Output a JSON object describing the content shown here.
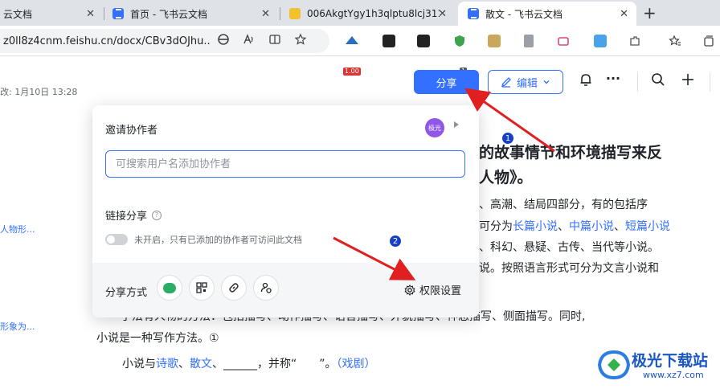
{
  "browser": {
    "tabs": [
      {
        "title": "云文档",
        "icon": "none",
        "active": false
      },
      {
        "title": "首页 - 飞书云文档",
        "icon": "doc",
        "active": false
      },
      {
        "title": "006AkgtYgy1h3qlptu8lcj311t0",
        "icon": "image",
        "active": false
      },
      {
        "title": "散文 - 飞书云文档",
        "icon": "doc",
        "active": true
      }
    ],
    "close_glyph": "✕",
    "new_tab_glyph": "+",
    "url": "z0ll8z4cnm.feishu.cn/docx/CBv3dOJhu...",
    "ext_badge_1": "1.00",
    "ext_badge_2": "1"
  },
  "doc_header": {
    "last_edit": "改: 1月10日 13:28",
    "share_label": "分享",
    "edit_label": "编辑",
    "more_glyph": "···"
  },
  "document": {
    "title_line1": "的故事情节和环境描写来反",
    "title_line2": "人物》。",
    "side_link_1": "人物形...",
    "side_link_2": "形象为...",
    "p1": "、高潮、结局四部分，有的包括序",
    "p2_prefix": "可分为",
    "p2_link1": "长篇小说",
    "p2_sep1": "、",
    "p2_link2": "中篇小说",
    "p2_sep2": "、",
    "p2_link3": "短篇小说",
    "p3": "、科幻、悬疑、古传、当代等小说。",
    "p4": "说。按照语言形式可分为文言小说和",
    "p5": "手法有人物的方法：包括描写、动作描写、语言描写、外貌描写、神态描写、侧面描写。同时,",
    "p6": "小说是一种写作方法。①",
    "p7_prefix": "小说与",
    "p7_link1": "诗歌",
    "p7_sep": "、",
    "p7_link2": "散文",
    "p7_mid": "、______，并称“　　”。",
    "p7_link3": "（戏剧）"
  },
  "share_popup": {
    "title": "邀请协作者",
    "avatar_text": "极光",
    "search_placeholder": "可搜索用户名添加协作者",
    "link_share_label": "链接分享",
    "help_glyph": "?",
    "toggle_text": "未开启，只有已添加的协作者可访问此文档",
    "toggle_on": false,
    "share_method_label": "分享方式",
    "permission_label": "权限设置"
  },
  "annotations": {
    "marker_1": "1",
    "marker_2": "2",
    "arrow_color": "#e02020"
  },
  "watermark": {
    "main": "极光下载站",
    "sub": "www.xz7.com"
  }
}
